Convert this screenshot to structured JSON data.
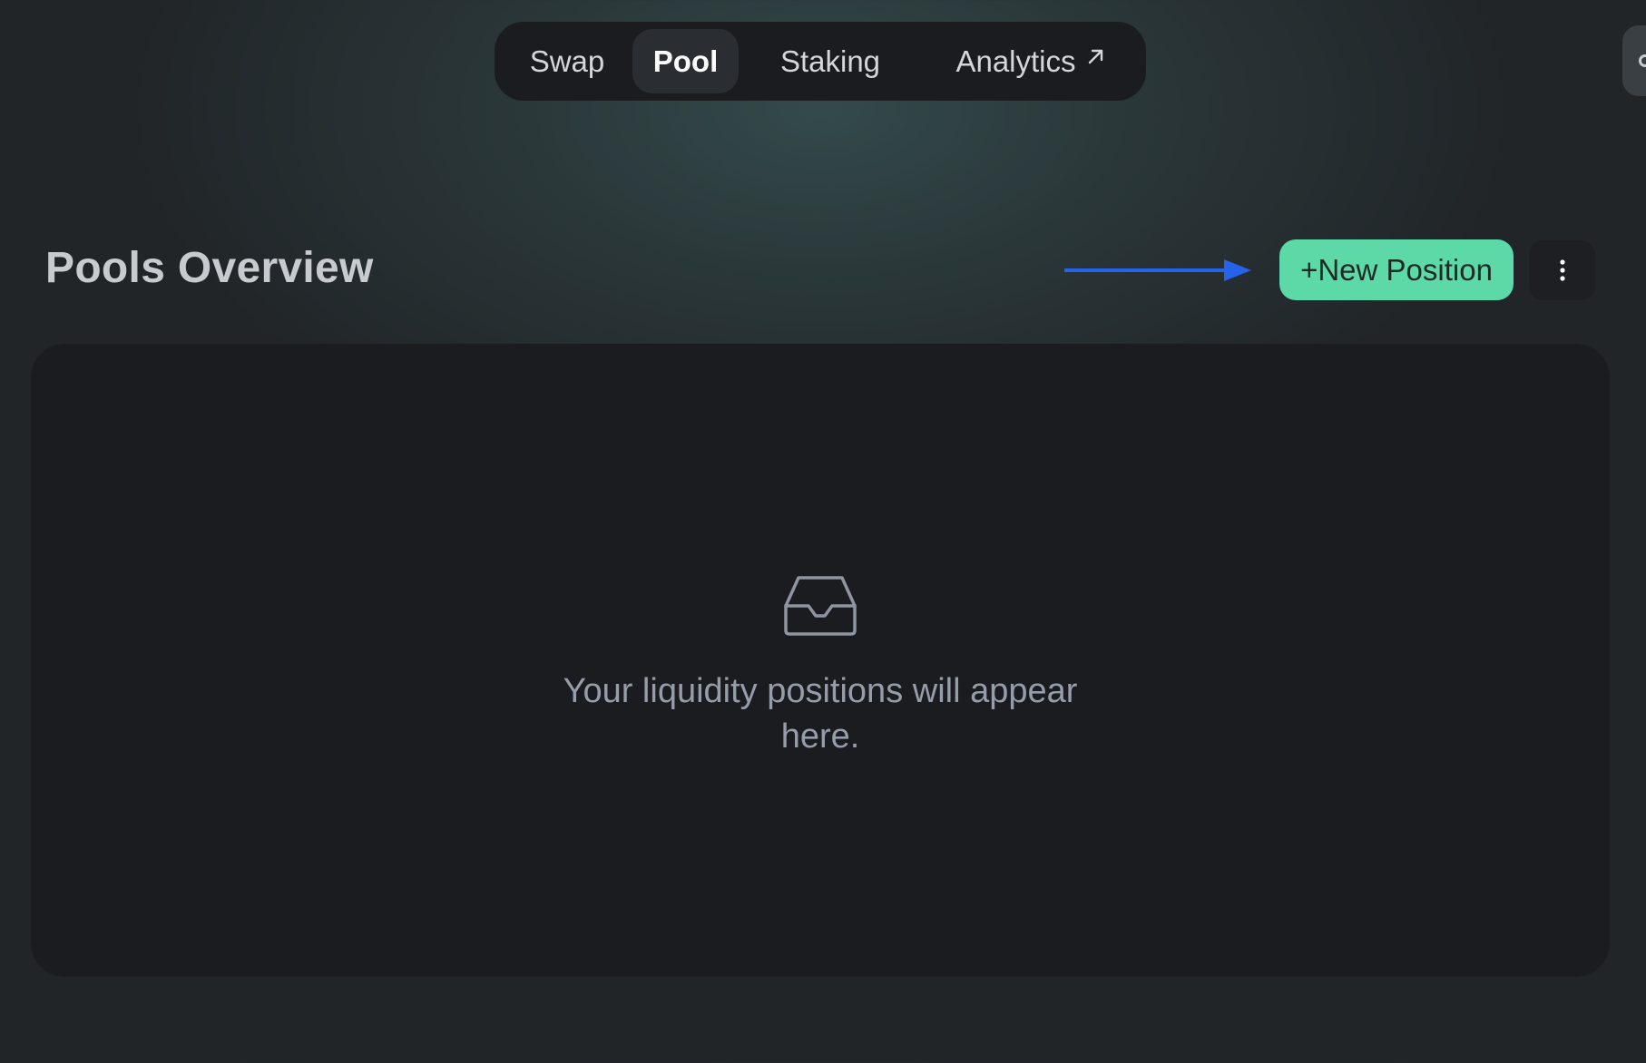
{
  "nav": {
    "tabs": [
      {
        "label": "Swap",
        "active": false
      },
      {
        "label": "Pool",
        "active": true
      },
      {
        "label": "Staking",
        "active": false
      },
      {
        "label": "Analytics",
        "active": false,
        "icon": "external-link-icon"
      }
    ]
  },
  "header": {
    "title": "Pools Overview",
    "new_position_label": "+New Position",
    "more_icon": "more-vertical-icon"
  },
  "empty_state": {
    "icon": "inbox-icon",
    "message": "Your liquidity positions will appear here."
  },
  "annotation": {
    "type": "arrow",
    "color": "#2563eb"
  },
  "colors": {
    "accent": "#5cd9a6",
    "card_bg": "#1b1c1f",
    "annotation_arrow": "#2563eb"
  }
}
